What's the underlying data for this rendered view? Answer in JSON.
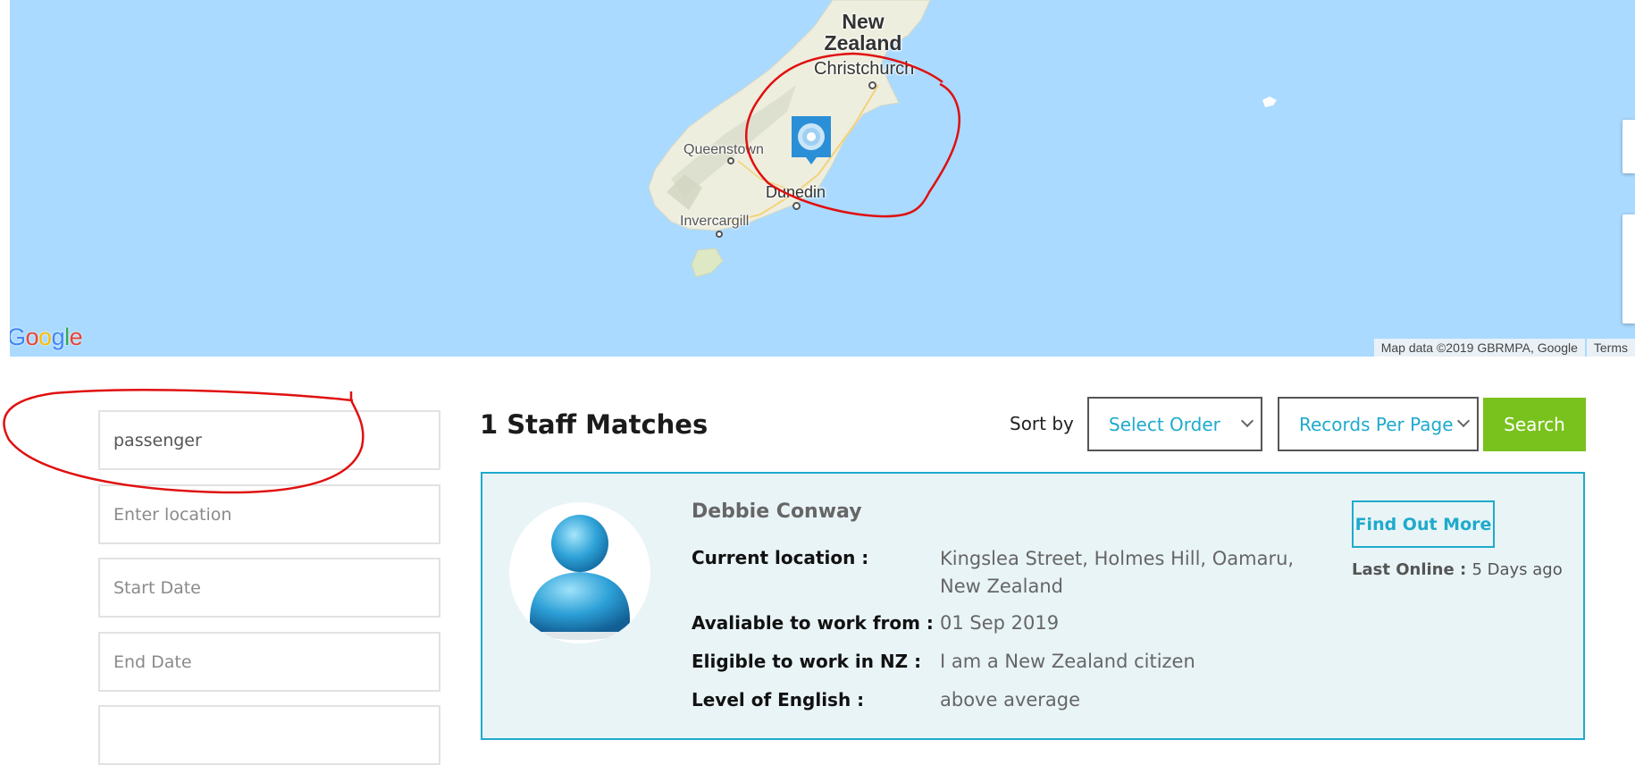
{
  "map": {
    "country_label": "New Zealand",
    "cities": [
      "Christchurch",
      "Queenstown",
      "Dunedin",
      "Invercargill"
    ],
    "logo_text": "Google",
    "attribution": "Map data ©2019 GBRMPA, Google",
    "terms_link": "Terms",
    "marker_icon": "profile-marker-icon"
  },
  "sidebar": {
    "keyword_value": "passenger",
    "location_placeholder": "Enter location",
    "start_date_placeholder": "Start Date",
    "end_date_placeholder": "End Date"
  },
  "results": {
    "title": "1 Staff Matches",
    "sort_label": "Sort by",
    "order_select": "Select Order",
    "per_page_select": "Records Per Page",
    "search_button": "Search"
  },
  "card": {
    "name": "Debbie Conway",
    "fields": [
      {
        "label": "Current location :",
        "value": "Kingslea Street, Holmes Hill, Oamaru, New Zealand"
      },
      {
        "label": "Avaliable to work from :",
        "value": "01 Sep 2019"
      },
      {
        "label": "Eligible to work in NZ :",
        "value": "I am a New Zealand citizen"
      },
      {
        "label": "Level of English :",
        "value": "above average"
      }
    ],
    "find_out_more": "Find Out More",
    "last_online_label": "Last Online :",
    "last_online_value": "5 Days ago"
  },
  "colors": {
    "water": "#aadaff",
    "accent": "#1eaacc",
    "search_button": "#79c21d",
    "card_bg": "#e9f4f7",
    "annotation": "#e01010"
  }
}
